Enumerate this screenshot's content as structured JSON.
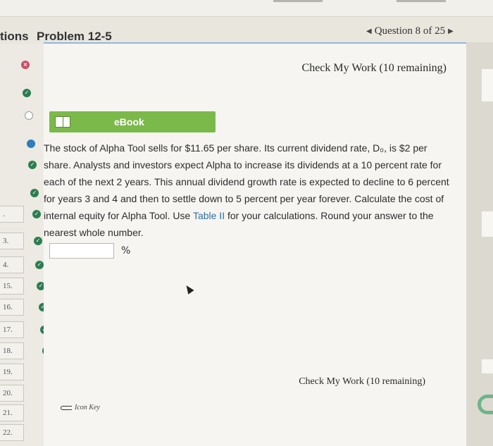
{
  "header": {
    "tab_label_fragment": "tions",
    "problem_title": "Problem 12-5",
    "question_nav": {
      "prev_arrow": "◀",
      "label": "Question 8 of 25",
      "next_arrow": "▶"
    }
  },
  "sidebar": {
    "items": [
      {
        "num": "",
        "status": "wrong"
      },
      {
        "num": "",
        "status": "correct"
      },
      {
        "num": "",
        "status": "empty"
      },
      {
        "num": "",
        "status": "current"
      },
      {
        "num": "",
        "status": "correct"
      },
      {
        "num": "",
        "status": "correct"
      },
      {
        "num": ".",
        "status": "correct"
      },
      {
        "num": "3.",
        "status": "correct"
      },
      {
        "num": "4.",
        "status": "correct"
      },
      {
        "num": "15.",
        "status": "correct"
      },
      {
        "num": "16.",
        "status": "correct"
      },
      {
        "num": "17.",
        "status": "correct"
      },
      {
        "num": "18.",
        "status": "correct"
      },
      {
        "num": "19.",
        "status": "correct"
      },
      {
        "num": "20.",
        "status": "correct"
      },
      {
        "num": "21.",
        "status": "correct"
      },
      {
        "num": "22.",
        "status": "correct"
      }
    ]
  },
  "main": {
    "check_my_work_top": "Check My Work (10 remaining)",
    "ebook_label": "eBook",
    "question_text_before_link": "The stock of Alpha Tool sells for $11.65 per share. Its current dividend rate, D₀, is $2 per share. Analysts and investors expect Alpha to increase its dividends at a 10 percent rate for each of the next 2 years. This annual dividend growth rate is expected to decline to 6 percent for years 3 and 4 and then to settle down to 5 percent per year forever. Calculate the cost of internal equity for Alpha Tool. Use ",
    "question_link_text": "Table II",
    "question_text_after_link": " for your calculations. Round your answer to the nearest whole number.",
    "answer_value": "",
    "answer_unit": "%",
    "check_my_work_bottom": "Check My Work (10 remaining)",
    "icon_key_label": "Icon Key"
  },
  "colors": {
    "ebook_green": "#7bb94a",
    "correct_green": "#2c7d52",
    "wrong_pink": "#c8516a",
    "current_blue": "#2f7dbb",
    "link_blue": "#2f6fa8",
    "frame_blue": "#8db8df"
  }
}
